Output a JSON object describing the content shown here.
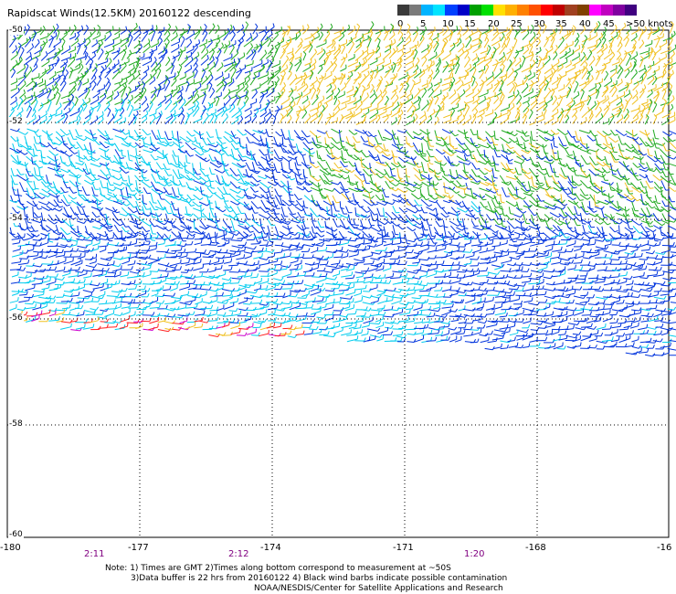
{
  "title": "Rapidscat Winds(12.5KM) 20160122 descending",
  "legend": {
    "colors": [
      "#3a3a3a",
      "#7a7a7a",
      "#00b4ff",
      "#00e4ff",
      "#0040ff",
      "#0000c8",
      "#00a000",
      "#00e000",
      "#ffe000",
      "#ffb000",
      "#ff8000",
      "#ff5000",
      "#ff0000",
      "#c00000",
      "#a04020",
      "#804000",
      "#ff00ff",
      "#c000c0",
      "#8000a0",
      "#400080"
    ],
    "labels": [
      "0",
      "5",
      "10",
      "15",
      "20",
      "25",
      "30",
      "35",
      "40",
      "45",
      ">50 knots"
    ]
  },
  "lat_labels": [
    "-50",
    "-52",
    "-54",
    "-56",
    "-58",
    "-60"
  ],
  "lon_labels": [
    "-180",
    "-177",
    "-174",
    "-171",
    "-168",
    "-16"
  ],
  "time_labels": [
    "2:11",
    "2:12",
    "1:20"
  ],
  "notes": [
    "Note: 1) Times are GMT 2)Times along bottom correspond to measurement at ~50S",
    "3)Data buffer is 22 hrs from 20160122 4) Black wind barbs indicate possible contamination",
    "NOAA/NESDIS/Center for Satellite Applications and Research"
  ],
  "colors": {
    "slow": "#00ccee",
    "medium": "#0033dd",
    "green": "#22aa22",
    "yellow": "#f0c020",
    "red": "#ff2020",
    "magenta": "#cc00cc",
    "time": "#800080"
  }
}
